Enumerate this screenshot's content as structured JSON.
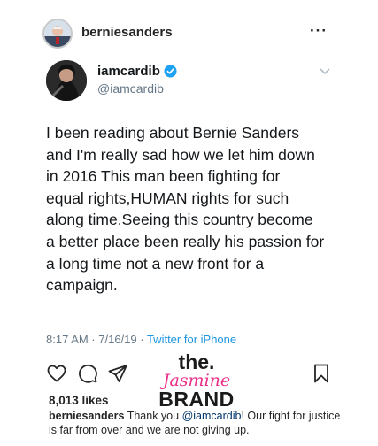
{
  "instagram_post": {
    "username": "berniesanders",
    "more_label": "···",
    "likes": "8,013 likes",
    "caption": {
      "user": "berniesanders",
      "text_before": " Thank you ",
      "mention": "@iamcardib",
      "text_after": "! Our fight for justice is far from over and we are not giving up."
    },
    "icons": {
      "avatar": "bernie-avatar",
      "more": "more-options-icon",
      "like": "heart-icon",
      "comment": "comment-icon",
      "share": "send-icon",
      "save": "bookmark-icon"
    }
  },
  "tweet": {
    "display_name": "iamcardib",
    "handle": "@iamcardib",
    "verified": true,
    "lines": [
      "I been reading about Bernie Sanders",
      "and I'm really sad how we let him down",
      "in 2016 This man been fighting for",
      "equal rights,HUMAN rights for such",
      "along time.Seeing this country become",
      "a better place been really his passion for",
      "a long time not a new front for a",
      "campaign."
    ],
    "timestamp": "8:17 AM · 7/16/19 · ",
    "source": "Twitter for iPhone",
    "colors": {
      "source_link": "#1b95e0",
      "verified": "#1da1f2"
    }
  },
  "watermark": {
    "the": "the.",
    "jasmine": "Jasmine",
    "brand": "BRAND",
    "accent_color": "#e8308a"
  }
}
